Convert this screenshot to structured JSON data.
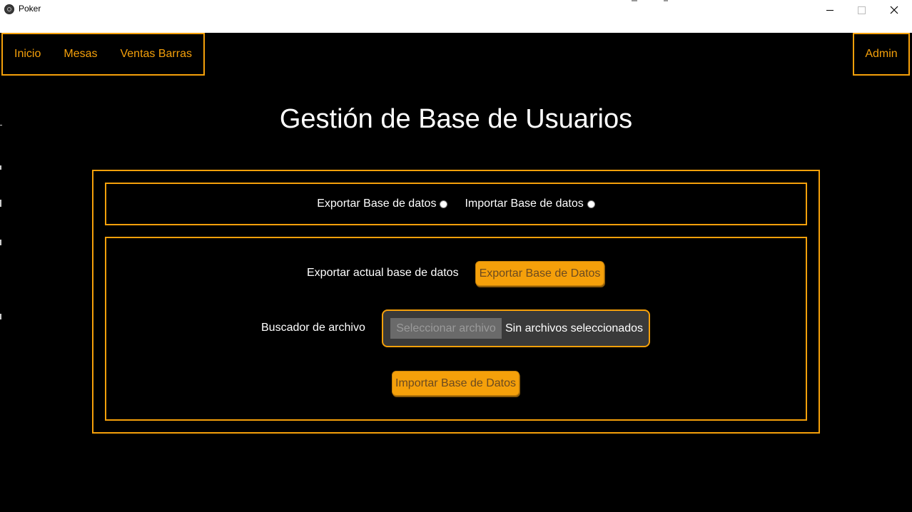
{
  "window": {
    "title": "Poker",
    "minimize_icon": "minimize-icon",
    "maximize_icon": "maximize-icon",
    "close_icon": "close-icon"
  },
  "nav": {
    "items": [
      {
        "label": "Inicio"
      },
      {
        "label": "Mesas"
      },
      {
        "label": "Ventas Barras"
      }
    ],
    "admin_label": "Admin"
  },
  "page": {
    "title": "Gestión de Base de Usuarios"
  },
  "mode": {
    "export_label": "Exportar Base de datos",
    "import_label": "Importar Base de datos",
    "selected": "none"
  },
  "export_section": {
    "label": "Exportar actual base de datos",
    "button_label": "Exportar Base de Datos"
  },
  "import_section": {
    "file_label": "Buscador de archivo",
    "file_button_label": "Seleccionar archivo",
    "file_status": "Sin archivos seleccionados",
    "button_label": "Importar Base de Datos"
  },
  "colors": {
    "accent": "#f5a00a",
    "background": "#000000",
    "text": "#ffffff"
  }
}
